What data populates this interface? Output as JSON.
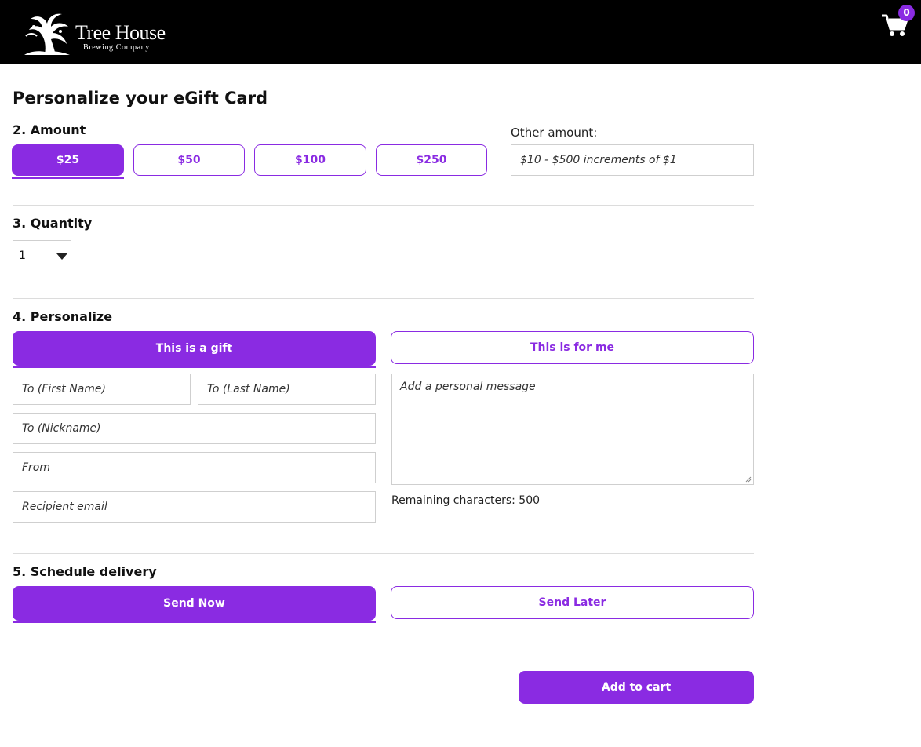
{
  "header": {
    "logo_main": "Tree House",
    "logo_sub": "Brewing Company",
    "cart_count": "0",
    "cart_icon": "shopping-cart-icon"
  },
  "page_title": "Personalize your eGift Card",
  "amount": {
    "label": "2. Amount",
    "options": [
      "$25",
      "$50",
      "$100",
      "$250"
    ],
    "selected": "$25",
    "other_label": "Other amount:",
    "other_placeholder": "$10 - $500 increments of $1"
  },
  "quantity": {
    "label": "3. Quantity",
    "value": "1"
  },
  "personalize": {
    "label": "4. Personalize",
    "gift_tab": "This is a gift",
    "me_tab": "This is for me",
    "selected": "This is a gift",
    "first_name_placeholder": "To (First Name)",
    "last_name_placeholder": "To (Last Name)",
    "nickname_placeholder": "To (Nickname)",
    "from_placeholder": "From",
    "email_placeholder": "Recipient email",
    "message_placeholder": "Add a personal message",
    "remaining_label": "Remaining characters:",
    "remaining_count": "500"
  },
  "delivery": {
    "label": "5. Schedule delivery",
    "send_now": "Send Now",
    "send_later": "Send Later",
    "selected": "Send Now"
  },
  "add_to_cart": "Add to cart",
  "colors": {
    "accent": "#8a2be2",
    "header_bg": "#000000"
  }
}
